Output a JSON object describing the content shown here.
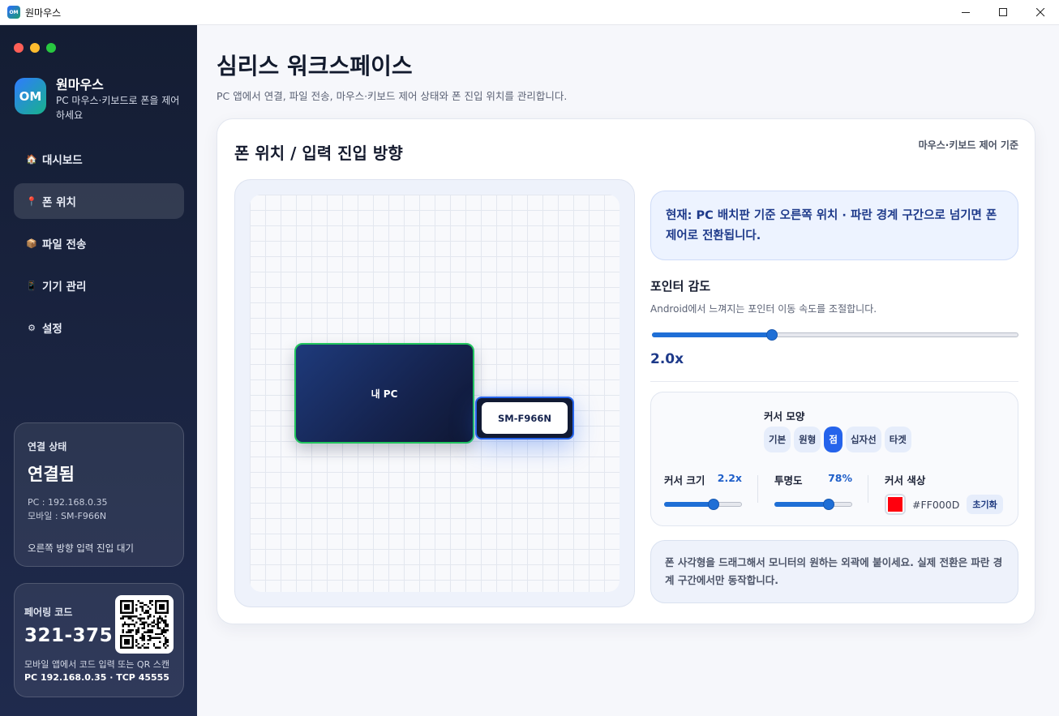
{
  "window": {
    "title": "원마우스",
    "app_icon_text": "OM"
  },
  "sidebar": {
    "logo_text": "OM",
    "brand_name": "원마우스",
    "brand_sub": "PC 마우스·키보드로 폰을 제어하세요",
    "nav": [
      {
        "label": "대시보드",
        "icon": "house-icon",
        "glyph": "🏠"
      },
      {
        "label": "폰 위치",
        "icon": "pin-icon",
        "glyph": "📍"
      },
      {
        "label": "파일 전송",
        "icon": "package-icon",
        "glyph": "📦"
      },
      {
        "label": "기기 관리",
        "icon": "device-icon",
        "glyph": "📱"
      },
      {
        "label": "설정",
        "icon": "gear-icon",
        "glyph": "⚙"
      }
    ],
    "active_index": 1,
    "status": {
      "label": "연결 상태",
      "value": "연결됨",
      "pc": "PC : 192.168.0.35",
      "mobile": "모바일 : SM-F966N",
      "wait": "오른쪽 방향 입력 진입 대기"
    },
    "pairing": {
      "label": "페어링 코드",
      "code": "321-375",
      "hint": "모바일 앱에서 코드 입력 또는 QR 스캔",
      "address": "PC 192.168.0.35 · TCP 45555"
    }
  },
  "main": {
    "title": "심리스 워크스페이스",
    "subtitle": "PC 앱에서 연결, 파일 전송, 마우스·키보드 제어 상태와 폰 진입 위치를 관리합니다.",
    "panel": {
      "title": "폰 위치 / 입력 진입 방향",
      "tag": "마우스·키보드 제어 기준",
      "pc_label": "내 PC",
      "phone_label": "SM-F966N",
      "info": "현재: PC 배치판 기준 오른쪽 위치 · 파란 경계 구간으로 넘기면 폰 제어로 전환됩니다.",
      "sensitivity": {
        "title": "포인터 감도",
        "sub": "Android에서 느껴지는 포인터 이동 속도를 조절합니다.",
        "value": "2.0x",
        "fraction": 0.33
      },
      "cursor": {
        "shape_title": "커서 모양",
        "shapes": [
          "기본",
          "원형",
          "점",
          "십자선",
          "타겟"
        ],
        "active_shape": 2,
        "size": {
          "label": "커서 크기",
          "value": "2.2x",
          "fraction": 0.64
        },
        "opacity": {
          "label": "투명도",
          "value": "78%",
          "fraction": 0.7
        },
        "color": {
          "label": "커서 색상",
          "hex": "#FF000D",
          "swatch": "#FF000D",
          "reset": "초기화"
        }
      },
      "hint": "폰 사각형을 드래그해서 모니터의 원하는 외곽에 붙이세요. 실제 전환은 파란 경계 구간에서만 동작합니다."
    }
  }
}
